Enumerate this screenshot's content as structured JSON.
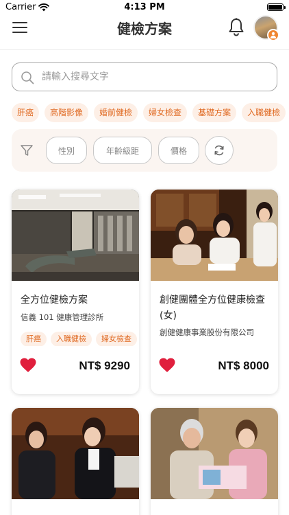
{
  "status_bar": {
    "carrier": "Carrier",
    "time": "4:13 PM"
  },
  "header": {
    "title": "健檢方案",
    "menu_icon": "hamburger-icon",
    "bell_icon": "bell-icon",
    "badge_icon": "user-badge-icon"
  },
  "search": {
    "placeholder": "請輸入搜尋文字",
    "value": ""
  },
  "tags": [
    "肝癌",
    "高階影像",
    "婚前健檢",
    "婦女檢查",
    "基礎方案",
    "入職健檢"
  ],
  "filters": {
    "gender": "性別",
    "age": "年齡級距",
    "price": "價格",
    "refresh_icon": "refresh-icon"
  },
  "colors": {
    "accent": "#e06a22",
    "tag_bg": "#fdefe6",
    "heart": "#e01f3d",
    "filter_bg": "#fbf5f1"
  },
  "cards": [
    {
      "title": "全方位健檢方案",
      "clinic": "信義 101 健康管理診所",
      "tags": [
        "肝癌",
        "入職健檢",
        "婦女檢查"
      ],
      "price": "NT$ 9290",
      "favorite": true
    },
    {
      "title": "創健團體全方位健康檢查(女)",
      "clinic": "創健健康事業股份有限公司",
      "tags": [],
      "price": "NT$ 8000",
      "favorite": true
    },
    {
      "title": "",
      "clinic": "",
      "tags": [],
      "price": "",
      "favorite": false
    },
    {
      "title": "",
      "clinic": "",
      "tags": [],
      "price": "",
      "favorite": false
    }
  ]
}
